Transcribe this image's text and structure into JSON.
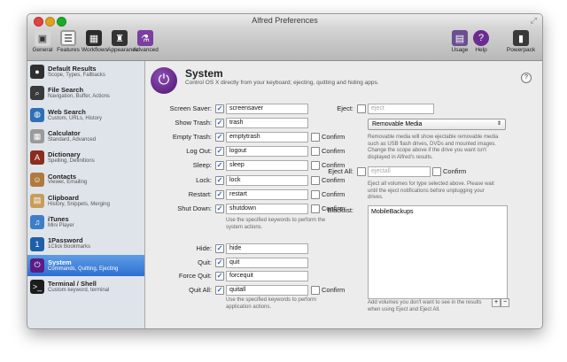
{
  "window": {
    "title": "Alfred Preferences"
  },
  "toolbar": {
    "left": [
      {
        "label": "General",
        "icon": "general-icon",
        "color": "#d6d6d6"
      },
      {
        "label": "Features",
        "icon": "features-icon",
        "color": "#f2f2f2"
      },
      {
        "label": "Workflows",
        "icon": "workflows-icon",
        "color": "#2b2b2b"
      },
      {
        "label": "Appearance",
        "icon": "appearance-icon",
        "color": "#333333"
      },
      {
        "label": "Advanced",
        "icon": "advanced-icon",
        "color": "#7b3fa0"
      }
    ],
    "right": [
      {
        "label": "Usage",
        "icon": "usage-icon",
        "color": "#6b4f8f"
      },
      {
        "label": "Help",
        "icon": "help-icon",
        "color": "#6a2c91"
      },
      {
        "label": "Powerpack",
        "icon": "powerpack-icon",
        "color": "#3a3a3a"
      }
    ]
  },
  "sidebar": {
    "items": [
      {
        "label": "Default Results",
        "sub": "Scope, Types, Fallbacks",
        "color": "#2f2f2f",
        "glyph": "●"
      },
      {
        "label": "File Search",
        "sub": "Navigation, Buffer, Actions",
        "color": "#3a3a3a",
        "glyph": "⌕"
      },
      {
        "label": "Web Search",
        "sub": "Custom, URLs, History",
        "color": "#2f6fb5",
        "glyph": "◍"
      },
      {
        "label": "Calculator",
        "sub": "Standard, Advanced",
        "color": "#9a9a9a",
        "glyph": "▦"
      },
      {
        "label": "Dictionary",
        "sub": "Spelling, Definitions",
        "color": "#8b2c1e",
        "glyph": "A"
      },
      {
        "label": "Contacts",
        "sub": "Viewer, Emailing",
        "color": "#b07a3e",
        "glyph": "☺"
      },
      {
        "label": "Clipboard",
        "sub": "History, Snippets, Merging",
        "color": "#c79d5a",
        "glyph": "▤"
      },
      {
        "label": "iTunes",
        "sub": "Mini Player",
        "color": "#3d7fc7",
        "glyph": "♫"
      },
      {
        "label": "1Password",
        "sub": "1Click Bookmarks",
        "color": "#1f5ea8",
        "glyph": "1"
      },
      {
        "label": "System",
        "sub": "Commands, Quitting, Ejecting",
        "color": "#5b1d85",
        "glyph": "⏻"
      },
      {
        "label": "Terminal / Shell",
        "sub": "Custom keyword, terminal",
        "color": "#1c1c1c",
        "glyph": ">_"
      }
    ],
    "selected_index": 9
  },
  "system": {
    "title": "System",
    "description": "Control OS X directly from your keyboard; ejecting, quitting and hiding apps.",
    "help_label": "?",
    "confirm_label": "Confirm",
    "commands": [
      {
        "label": "Screen Saver:",
        "keyword": "screensaver",
        "has_confirm": false
      },
      {
        "label": "Show Trash:",
        "keyword": "trash",
        "has_confirm": false
      },
      {
        "label": "Empty Trash:",
        "keyword": "emptytrash",
        "has_confirm": true
      },
      {
        "label": "Log Out:",
        "keyword": "logout",
        "has_confirm": true
      },
      {
        "label": "Sleep:",
        "keyword": "sleep",
        "has_confirm": true
      },
      {
        "label": "Lock:",
        "keyword": "lock",
        "has_confirm": true
      },
      {
        "label": "Restart:",
        "keyword": "restart",
        "has_confirm": true
      },
      {
        "label": "Shut Down:",
        "keyword": "shutdown",
        "has_confirm": true
      }
    ],
    "system_note": "Use the specified keywords to perform the system actions.",
    "app_commands": [
      {
        "label": "Hide:",
        "keyword": "hide",
        "has_confirm": false
      },
      {
        "label": "Quit:",
        "keyword": "quit",
        "has_confirm": false
      },
      {
        "label": "Force Quit:",
        "keyword": "forcequit",
        "has_confirm": false
      },
      {
        "label": "Quit All:",
        "keyword": "quitall",
        "has_confirm": true
      }
    ],
    "app_note": "Use the specified keywords to perform application actions.",
    "eject": {
      "label": "Eject:",
      "placeholder": "eject",
      "select_value": "Removable Media",
      "note": "Removable media will show ejectable removable media such as USB flash drives, DVDs and mounted images. Change the scope above if the drive you want isn't displayed in Alfred's results."
    },
    "eject_all": {
      "label": "Eject All:",
      "placeholder": "ejectall",
      "note": "Eject all volumes for type selected above. Please wait until the eject notifications before unplugging your drives."
    },
    "blacklist": {
      "label": "Blacklist:",
      "items": [
        "MobileBackups"
      ],
      "note": "Add volumes you don't want to see in the results when using Eject and Eject All.",
      "add_label": "+",
      "remove_label": "−"
    }
  }
}
